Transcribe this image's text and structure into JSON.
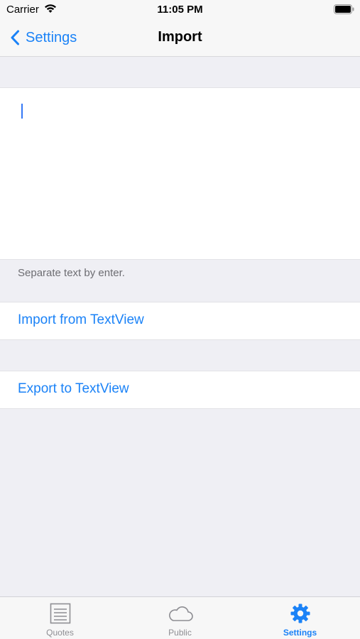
{
  "status_bar": {
    "carrier": "Carrier",
    "time": "11:05 PM"
  },
  "nav": {
    "back_label": "Settings",
    "title": "Import"
  },
  "text_view": {
    "value": ""
  },
  "footer_note": "Separate text by enter.",
  "actions": {
    "import_label": "Import from TextView",
    "export_label": "Export to TextView"
  },
  "tabs": [
    {
      "label": "Quotes",
      "icon": "list-icon",
      "active": false
    },
    {
      "label": "Public",
      "icon": "cloud-icon",
      "active": false
    },
    {
      "label": "Settings",
      "icon": "gear-icon",
      "active": true
    }
  ],
  "colors": {
    "accent": "#1a82f7",
    "background": "#efeff4",
    "inactive_tab": "#8e8e93"
  }
}
